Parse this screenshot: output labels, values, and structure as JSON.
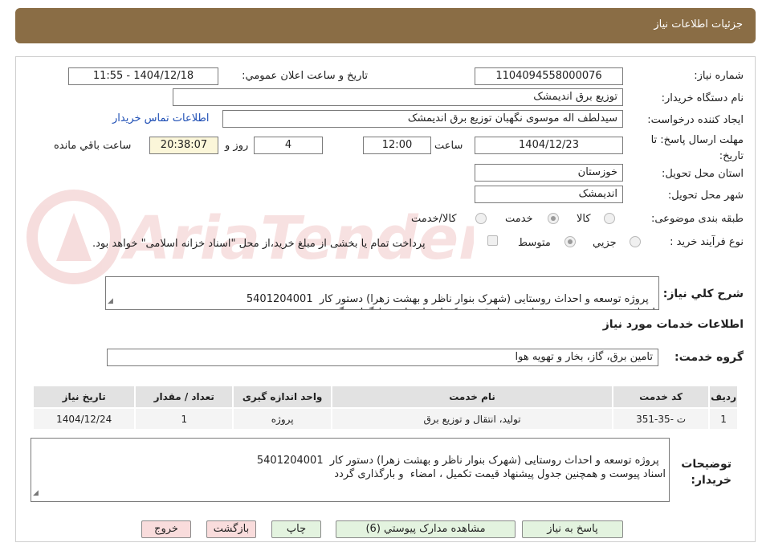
{
  "header": {
    "title": "جزئیات اطلاعات نیاز"
  },
  "watermark": {
    "text": "AriaTender.neT"
  },
  "form": {
    "need_number": {
      "label": "شماره نیاز:",
      "value": "1104094558000076"
    },
    "announce": {
      "label": "تاریخ و ساعت اعلان عمومي:",
      "value": "1404/12/18 - 11:55"
    },
    "buyer_org": {
      "label": "نام دستگاه خریدار:",
      "value": "توزيع برق انديمشک"
    },
    "requester": {
      "label": "ایجاد کننده درخواست:",
      "value": "سیدلطف اله موسوی نگهبان توزیع برق اندیمشک",
      "contact_link": "اطلاعات تماس خریدار"
    },
    "deadline": {
      "label": "مهلت ارسال پاسخ: تا تاریخ:",
      "date": "1404/12/23",
      "time_label": "ساعت",
      "time": "12:00",
      "days": "4",
      "days_label": "روز و",
      "remaining": "20:38:07",
      "remaining_label": "ساعت باقي مانده"
    },
    "province": {
      "label": "استان محل تحویل:",
      "value": "خوزستان"
    },
    "city": {
      "label": "شهر محل تحویل:",
      "value": "انديمشک"
    },
    "category": {
      "label": "طبقه بندی موضوعی:",
      "options": [
        "کالا",
        "خدمت",
        "کالا/خدمت"
      ],
      "selected": "خدمت"
    },
    "purchase_type": {
      "label": "نوع فرآیند خرید :",
      "options": [
        "جزيي",
        "متوسط"
      ],
      "selected": "متوسط",
      "treasury_note": "پرداخت تمام یا بخشی از مبلغ خرید،از محل \"اسناد خزانه اسلامی\" خواهد بود."
    },
    "description": {
      "label": "شرح کلي نیاز:",
      "value": "پروژه توسعه و احداث روستایی (شهرک بنوار ناظر و بهشت زهرا) دستور کار  5401204001\nاسناد پیوست و همچنین جدول پیشنهاد قیمت تکمیل ، امضاء  و بارگذاری گردد"
    }
  },
  "services": {
    "section_title": "اطلاعات خدمات مورد نیاز",
    "group_label": "گروه خدمت:",
    "group_value": "تامین برق، گاز، بخار و تهویه هوا",
    "table": {
      "headers": [
        "ردیف",
        "کد خدمت",
        "نام خدمت",
        "واحد اندازه گیری",
        "تعداد / مقدار",
        "تاریخ نیاز"
      ],
      "rows": [
        [
          "1",
          "ت -35-351",
          "تولید، انتقال و توزیع برق",
          "پروژه",
          "1",
          "1404/12/24"
        ]
      ]
    },
    "buyer_notes_label": "توضیحات خریدار:",
    "buyer_notes": "پروژه توسعه و احداث روستایی (شهرک بنوار ناظر و بهشت زهرا) دستور کار  5401204001\nاسناد پیوست و همچنین جدول پیشنهاد قیمت تکمیل ، امضاء  و بارگذاری گردد"
  },
  "buttons": {
    "reply": "پاسخ به نیاز",
    "attachments": "مشاهده مدارک پیوستي (6)",
    "print": "چاپ",
    "back": "بازگشت",
    "exit": "خروج"
  }
}
